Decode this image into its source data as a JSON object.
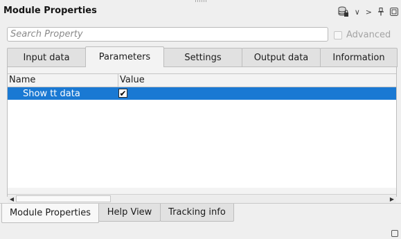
{
  "header": {
    "title": "Module Properties",
    "icons": {
      "database": "database-lock-icon",
      "collapse": "chevron-down-icon",
      "expand": "chevron-right-icon",
      "pin": "pin-icon",
      "float": "float-window-icon"
    },
    "collapse_glyph": "∨",
    "expand_glyph": ">"
  },
  "search": {
    "placeholder": "Search Property",
    "value": ""
  },
  "advanced": {
    "label": "Advanced",
    "checked": false
  },
  "tabs": [
    {
      "label": "Input data",
      "active": false
    },
    {
      "label": "Parameters",
      "active": true
    },
    {
      "label": "Settings",
      "active": false
    },
    {
      "label": "Output data",
      "active": false
    },
    {
      "label": "Information",
      "active": false
    }
  ],
  "table": {
    "columns": [
      "Name",
      "Value"
    ],
    "rows": [
      {
        "name": "Show tt data",
        "checked": true,
        "check_glyph": "✔"
      }
    ]
  },
  "bottom_tabs": [
    {
      "label": "Module Properties",
      "active": true
    },
    {
      "label": "Help View",
      "active": false
    },
    {
      "label": "Tracking info",
      "active": false
    }
  ],
  "colors": {
    "selection": "#1a79d3",
    "background": "#efefef"
  }
}
